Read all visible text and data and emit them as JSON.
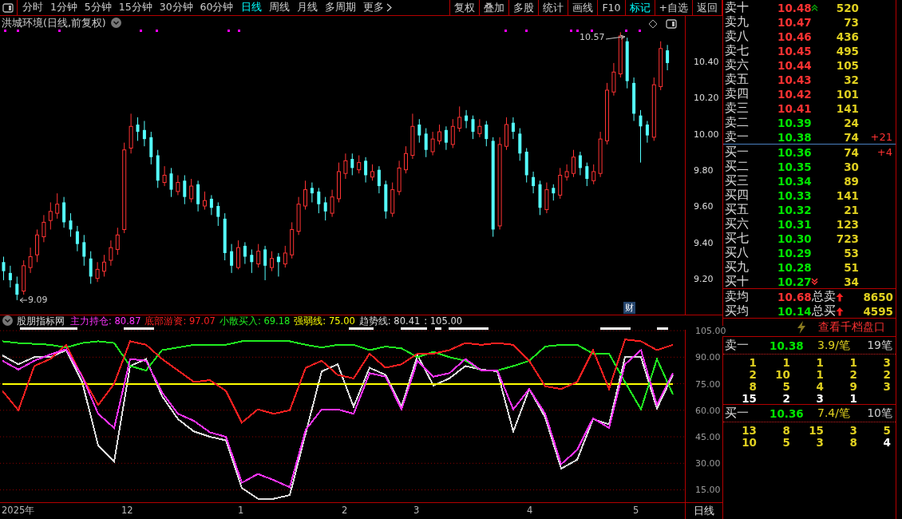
{
  "toolbar": {
    "periods": [
      {
        "label": "分时",
        "selected": false
      },
      {
        "label": "1分钟",
        "selected": false
      },
      {
        "label": "5分钟",
        "selected": false
      },
      {
        "label": "15分钟",
        "selected": false
      },
      {
        "label": "30分钟",
        "selected": false
      },
      {
        "label": "60分钟",
        "selected": false
      },
      {
        "label": "日线",
        "selected": true
      },
      {
        "label": "周线",
        "selected": false
      },
      {
        "label": "月线",
        "selected": false
      },
      {
        "label": "多周期",
        "selected": false
      }
    ],
    "more": "更多",
    "buttons": [
      {
        "label": "复权",
        "selected": false
      },
      {
        "label": "叠加",
        "selected": false
      },
      {
        "label": "多股",
        "selected": false
      },
      {
        "label": "统计",
        "selected": false
      },
      {
        "label": "画线",
        "selected": false
      },
      {
        "label": "F10",
        "selected": false
      },
      {
        "label": "标记",
        "selected": true
      },
      {
        "label": "+自选",
        "selected": false
      },
      {
        "label": "返回",
        "selected": false
      }
    ]
  },
  "price_chart": {
    "title": "洪城环境(日线,前复权)",
    "high_label": "10.57",
    "low_label": "9.09",
    "badge": "财",
    "chart_data": {
      "type": "candlestick",
      "ylim": [
        9.01,
        10.66
      ],
      "yticks": [
        {
          "value": 10.4,
          "label": "10.40"
        },
        {
          "value": 10.2,
          "label": "10.20"
        },
        {
          "value": 10.0,
          "label": "10.00"
        },
        {
          "value": 9.8,
          "label": "9.80"
        },
        {
          "value": 9.6,
          "label": "9.60"
        },
        {
          "value": 9.4,
          "label": "9.40"
        },
        {
          "value": 9.2,
          "label": "9.20"
        }
      ],
      "ohlc": [
        [
          9.3,
          9.33,
          9.2,
          9.25
        ],
        [
          9.24,
          9.28,
          9.16,
          9.2
        ],
        [
          9.18,
          9.22,
          9.09,
          9.12
        ],
        [
          9.14,
          9.31,
          9.12,
          9.28
        ],
        [
          9.27,
          9.38,
          9.24,
          9.33
        ],
        [
          9.34,
          9.48,
          9.3,
          9.45
        ],
        [
          9.44,
          9.56,
          9.41,
          9.52
        ],
        [
          9.53,
          9.63,
          9.48,
          9.58
        ],
        [
          9.57,
          9.68,
          9.54,
          9.62
        ],
        [
          9.63,
          9.66,
          9.49,
          9.52
        ],
        [
          9.53,
          9.57,
          9.44,
          9.48
        ],
        [
          9.47,
          9.5,
          9.36,
          9.4
        ],
        [
          9.41,
          9.45,
          9.28,
          9.33
        ],
        [
          9.32,
          9.36,
          9.18,
          9.22
        ],
        [
          9.21,
          9.3,
          9.19,
          9.26
        ],
        [
          9.25,
          9.34,
          9.22,
          9.3
        ],
        [
          9.31,
          9.42,
          9.28,
          9.38
        ],
        [
          9.37,
          9.49,
          9.34,
          9.45
        ],
        [
          9.48,
          9.96,
          9.46,
          9.92
        ],
        [
          9.93,
          10.12,
          9.9,
          10.05
        ],
        [
          10.06,
          10.1,
          9.97,
          10.02
        ],
        [
          10.03,
          10.08,
          9.94,
          9.98
        ],
        [
          9.99,
          10.02,
          9.84,
          9.88
        ],
        [
          9.89,
          9.92,
          9.71,
          9.75
        ],
        [
          9.74,
          9.83,
          9.72,
          9.78
        ],
        [
          9.79,
          9.82,
          9.66,
          9.7
        ],
        [
          9.69,
          9.78,
          9.67,
          9.74
        ],
        [
          9.75,
          9.78,
          9.62,
          9.66
        ],
        [
          9.65,
          9.76,
          9.63,
          9.72
        ],
        [
          9.73,
          9.75,
          9.58,
          9.62
        ],
        [
          9.61,
          9.69,
          9.59,
          9.64
        ],
        [
          9.65,
          9.67,
          9.56,
          9.6
        ],
        [
          9.61,
          9.63,
          9.5,
          9.55
        ],
        [
          9.54,
          9.57,
          9.31,
          9.35
        ],
        [
          9.36,
          9.4,
          9.24,
          9.28
        ],
        [
          9.27,
          9.42,
          9.26,
          9.38
        ],
        [
          9.39,
          9.41,
          9.29,
          9.33
        ],
        [
          9.34,
          9.37,
          9.24,
          9.3
        ],
        [
          9.29,
          9.4,
          9.27,
          9.36
        ],
        [
          9.37,
          9.39,
          9.2,
          9.28
        ],
        [
          9.27,
          9.36,
          9.25,
          9.32
        ],
        [
          9.33,
          9.35,
          9.22,
          9.3
        ],
        [
          9.29,
          9.39,
          9.27,
          9.35
        ],
        [
          9.34,
          9.52,
          9.32,
          9.48
        ],
        [
          9.47,
          9.66,
          9.45,
          9.62
        ],
        [
          9.61,
          9.75,
          9.59,
          9.7
        ],
        [
          9.71,
          9.74,
          9.63,
          9.68
        ],
        [
          9.69,
          9.71,
          9.57,
          9.62
        ],
        [
          9.63,
          9.66,
          9.53,
          9.58
        ],
        [
          9.57,
          9.7,
          9.55,
          9.66
        ],
        [
          9.65,
          9.85,
          9.63,
          9.8
        ],
        [
          9.79,
          9.9,
          9.76,
          9.86
        ],
        [
          9.87,
          9.9,
          9.78,
          9.82
        ],
        [
          9.81,
          9.89,
          9.79,
          9.85
        ],
        [
          9.86,
          9.88,
          9.74,
          9.78
        ],
        [
          9.77,
          9.84,
          9.75,
          9.8
        ],
        [
          9.81,
          9.83,
          9.68,
          9.72
        ],
        [
          9.73,
          9.75,
          9.54,
          9.58
        ],
        [
          9.57,
          9.74,
          9.55,
          9.7
        ],
        [
          9.69,
          9.86,
          9.67,
          9.82
        ],
        [
          9.81,
          9.94,
          9.79,
          9.9
        ],
        [
          9.89,
          10.12,
          9.87,
          10.05
        ],
        [
          10.06,
          10.09,
          9.96,
          10.0
        ],
        [
          10.01,
          10.04,
          9.88,
          9.92
        ],
        [
          9.91,
          10.02,
          9.89,
          9.98
        ],
        [
          9.97,
          10.06,
          9.95,
          10.02
        ],
        [
          10.03,
          10.05,
          9.92,
          9.96
        ],
        [
          9.95,
          10.09,
          9.93,
          10.05
        ],
        [
          10.04,
          10.16,
          10.02,
          10.1
        ],
        [
          10.11,
          10.14,
          10.04,
          10.08
        ],
        [
          10.09,
          10.11,
          9.98,
          10.02
        ],
        [
          10.01,
          10.09,
          9.99,
          10.05
        ],
        [
          10.06,
          10.08,
          9.94,
          9.98
        ],
        [
          9.97,
          9.99,
          9.44,
          9.48
        ],
        [
          9.5,
          9.99,
          9.48,
          9.95
        ],
        [
          9.94,
          10.1,
          9.92,
          10.06
        ],
        [
          10.07,
          10.1,
          9.98,
          10.02
        ],
        [
          10.01,
          10.04,
          9.86,
          9.9
        ],
        [
          9.91,
          9.93,
          9.74,
          9.78
        ],
        [
          9.77,
          9.8,
          9.68,
          9.72
        ],
        [
          9.73,
          9.75,
          9.56,
          9.6
        ],
        [
          9.59,
          9.74,
          9.57,
          9.7
        ],
        [
          9.71,
          9.73,
          9.64,
          9.68
        ],
        [
          9.67,
          9.82,
          9.65,
          9.78
        ],
        [
          9.77,
          9.84,
          9.75,
          9.8
        ],
        [
          9.79,
          9.92,
          9.77,
          9.88
        ],
        [
          9.89,
          9.91,
          9.78,
          9.82
        ],
        [
          9.83,
          9.85,
          9.72,
          9.76
        ],
        [
          9.75,
          9.84,
          9.73,
          9.8
        ],
        [
          9.79,
          10.02,
          9.77,
          9.98
        ],
        [
          9.97,
          10.29,
          9.95,
          10.25
        ],
        [
          10.24,
          10.4,
          10.22,
          10.35
        ],
        [
          10.34,
          10.57,
          10.32,
          10.55
        ],
        [
          10.52,
          10.54,
          10.26,
          10.3
        ],
        [
          10.29,
          10.32,
          10.08,
          10.12
        ],
        [
          10.11,
          10.14,
          9.85,
          10.05
        ],
        [
          10.06,
          10.08,
          9.96,
          10.0
        ],
        [
          9.99,
          10.32,
          9.97,
          10.28
        ],
        [
          10.27,
          10.52,
          10.25,
          10.48
        ],
        [
          10.47,
          10.5,
          10.36,
          10.4
        ]
      ]
    }
  },
  "indicator": {
    "name": "股朋指标网",
    "readings": [
      ": 80.87",
      ": 97.07",
      ": 69.18",
      ": 75.00",
      ": 80.41"
    ],
    "extra": ": 105.00",
    "chart_data": {
      "type": "line",
      "grid": true,
      "ylim": [
        8,
        105.5
      ],
      "yticks": [
        {
          "value": 105,
          "label": "105.00"
        },
        {
          "value": 90,
          "label": "90.00"
        },
        {
          "value": 75,
          "label": "75.00"
        },
        {
          "value": 60,
          "label": "60.00"
        },
        {
          "value": 45,
          "label": "45.00"
        },
        {
          "value": 30,
          "label": "30.00"
        },
        {
          "value": 15,
          "label": "15.00"
        }
      ],
      "series": [
        {
          "name": "主力持仓",
          "color": "#ff33ff",
          "values": [
            88,
            83,
            88,
            91.5,
            94.5,
            79,
            58,
            50,
            89,
            88,
            70,
            58,
            54,
            47.5,
            45,
            19,
            24,
            20.5,
            16.5,
            49,
            60.5,
            60.5,
            58,
            81,
            79,
            60.5,
            88,
            79,
            81,
            89,
            82.5,
            82.5,
            60.5,
            72,
            58,
            29.5,
            37.5,
            55.5,
            50,
            86,
            94,
            63,
            81
          ]
        },
        {
          "name": "底部游资",
          "color": "#ff2020",
          "values": [
            71,
            60,
            85,
            89,
            97,
            79,
            63,
            75,
            99,
            97,
            89,
            82.5,
            76,
            77,
            71,
            53,
            60.5,
            58,
            60,
            84,
            88,
            80,
            78,
            92,
            84,
            86,
            92,
            92,
            94,
            98,
            97,
            98,
            97,
            88,
            73.5,
            72,
            76,
            94,
            72,
            100,
            99,
            94,
            97
          ]
        },
        {
          "name": "小散买入",
          "color": "#20ee20",
          "values": [
            99,
            98,
            97.5,
            97,
            95.5,
            98,
            99,
            98,
            85,
            82.5,
            94,
            95.5,
            97,
            97,
            97,
            99,
            99,
            99,
            99,
            97,
            95.5,
            97,
            97,
            94,
            96,
            95,
            90,
            93,
            90,
            88,
            82.5,
            82.5,
            85,
            88,
            96,
            97,
            97,
            92,
            92,
            76,
            60.5,
            89,
            69
          ]
        },
        {
          "name": "强弱线",
          "color": "#ffff00",
          "values": [
            75,
            75,
            75,
            75,
            75,
            75,
            75,
            75,
            75,
            75,
            75,
            75,
            75,
            75,
            75,
            75,
            75,
            75,
            75,
            75,
            75,
            75,
            75,
            75,
            75,
            75,
            75,
            75,
            75,
            75,
            75,
            75,
            75,
            75,
            75,
            75,
            75,
            75,
            75,
            75,
            75,
            75,
            75
          ]
        },
        {
          "name": "趋势线",
          "color": "#dddddd",
          "values": [
            91,
            86,
            90,
            90,
            94,
            76,
            40,
            31,
            85,
            89,
            68,
            55,
            48,
            45,
            43,
            16,
            10,
            10,
            12,
            47,
            82,
            86,
            62,
            84,
            80,
            62,
            91,
            74,
            78,
            85,
            83,
            82,
            48,
            72,
            56,
            27,
            32,
            55,
            52,
            90,
            90,
            61,
            80
          ]
        }
      ]
    }
  },
  "time_axis": {
    "labels": [
      "2025年",
      "12",
      "1",
      "2",
      "3",
      "4",
      "5"
    ],
    "period": "日线"
  },
  "order_book": {
    "asks": [
      {
        "label": "卖十",
        "price": "10.48",
        "up": true,
        "volume": "520",
        "arrow_up": true
      },
      {
        "label": "卖九",
        "price": "10.47",
        "up": true,
        "volume": "73"
      },
      {
        "label": "卖八",
        "price": "10.46",
        "up": true,
        "volume": "436"
      },
      {
        "label": "卖七",
        "price": "10.45",
        "up": true,
        "volume": "495"
      },
      {
        "label": "卖六",
        "price": "10.44",
        "up": true,
        "volume": "105"
      },
      {
        "label": "卖五",
        "price": "10.43",
        "up": true,
        "volume": "32"
      },
      {
        "label": "卖四",
        "price": "10.42",
        "up": true,
        "volume": "101"
      },
      {
        "label": "卖三",
        "price": "10.41",
        "up": true,
        "volume": "141"
      },
      {
        "label": "卖二",
        "price": "10.39",
        "up": false,
        "volume": "24"
      },
      {
        "label": "卖一",
        "price": "10.38",
        "up": false,
        "volume": "74",
        "change": "+21"
      }
    ],
    "bids": [
      {
        "label": "买一",
        "price": "10.36",
        "up": false,
        "volume": "74",
        "change": "+4"
      },
      {
        "label": "买二",
        "price": "10.35",
        "up": false,
        "volume": "30"
      },
      {
        "label": "买三",
        "price": "10.34",
        "up": false,
        "volume": "89"
      },
      {
        "label": "买四",
        "price": "10.33",
        "up": false,
        "volume": "141"
      },
      {
        "label": "买五",
        "price": "10.32",
        "up": false,
        "volume": "21"
      },
      {
        "label": "买六",
        "price": "10.31",
        "up": false,
        "volume": "123"
      },
      {
        "label": "买七",
        "price": "10.30",
        "up": false,
        "volume": "723"
      },
      {
        "label": "买八",
        "price": "10.29",
        "up": false,
        "volume": "53"
      },
      {
        "label": "买九",
        "price": "10.28",
        "up": false,
        "volume": "51"
      },
      {
        "label": "买十",
        "price": "10.27",
        "up": false,
        "volume": "34",
        "arrow_down": true
      }
    ],
    "summary": [
      {
        "label": "卖均",
        "price": "10.68",
        "up": true,
        "total_label": "总卖",
        "total": "8650"
      },
      {
        "label": "买均",
        "price": "10.14",
        "up": false,
        "total_label": "总买",
        "total": "4595"
      }
    ],
    "depth_link": "查看千档盘口",
    "queues": [
      {
        "label": "卖一",
        "price": "10.38",
        "up": false,
        "per_order": "3.9/笔",
        "orders": "19笔",
        "rows": [
          [
            {
              "v": "1",
              "latest": false
            },
            {
              "v": "1",
              "latest": false
            },
            {
              "v": "1",
              "latest": false
            },
            {
              "v": "1",
              "latest": false
            },
            {
              "v": "3",
              "latest": false
            }
          ],
          [
            {
              "v": "2",
              "latest": false
            },
            {
              "v": "10",
              "latest": false
            },
            {
              "v": "1",
              "latest": false
            },
            {
              "v": "2",
              "latest": false
            },
            {
              "v": "2",
              "latest": false
            }
          ],
          [
            {
              "v": "8",
              "latest": false
            },
            {
              "v": "5",
              "latest": false
            },
            {
              "v": "4",
              "latest": false
            },
            {
              "v": "9",
              "latest": false
            },
            {
              "v": "3",
              "latest": false
            }
          ],
          [
            {
              "v": "15",
              "latest": true
            },
            {
              "v": "2",
              "latest": true
            },
            {
              "v": "3",
              "latest": true
            },
            {
              "v": "1",
              "latest": true
            }
          ]
        ]
      },
      {
        "label": "买一",
        "price": "10.36",
        "up": false,
        "per_order": "7.4/笔",
        "orders": "10笔",
        "rows": [
          [
            {
              "v": "13",
              "latest": false
            },
            {
              "v": "8",
              "latest": false
            },
            {
              "v": "15",
              "latest": false
            },
            {
              "v": "3",
              "latest": false
            },
            {
              "v": "5",
              "latest": false
            }
          ],
          [
            {
              "v": "10",
              "latest": false
            },
            {
              "v": "5",
              "latest": false
            },
            {
              "v": "3",
              "latest": false
            },
            {
              "v": "8",
              "latest": false
            },
            {
              "v": "4",
              "latest": true
            }
          ]
        ]
      }
    ]
  }
}
